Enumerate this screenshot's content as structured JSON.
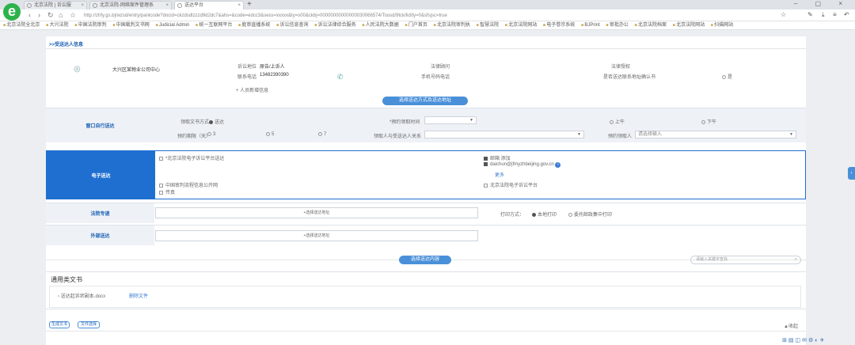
{
  "browser": {
    "tabs": [
      {
        "label": "北京法院 | 诉讼服"
      },
      {
        "label": "北京法院-网络案件管理系"
      },
      {
        "label": "送达平台"
      }
    ],
    "url": "http://zhfy.gs.bj/wzsd/entry/panlcode?docid=ckzdsdlzzzd9d2dc7&ahs=&code=edcc3&sess=xxxxx&ty=s00&ckbj=00000000000000030066574/Toosd/9tck/lid/ty=0&sfsjsc=true",
    "bookmarks": [
      "北京法院全北京",
      "大兴法院",
      "中国法院审判",
      "中国裁判文书网",
      "Judicial Admin",
      "统一互联网平台",
      "庭审直播系统",
      "诉讼信息查询",
      "诉讼法律综合服务",
      "人民法院大数据",
      "门户首页",
      "北京法院审判执",
      "智慧法院",
      "北京法院网站",
      "电子卷宗系统",
      "BJPrint",
      "审批办公",
      "北京法院档案",
      "北京法院网站",
      "扫描网站"
    ]
  },
  "page": {
    "section_title": ">>受送达人信息",
    "party": {
      "name": "大兴区某物业公司中心",
      "type_label": "诉讼地位",
      "type_value": "原告/上诉人",
      "phone_label": "联系电话",
      "phone_value": "13482390390",
      "court_label": "法律顾问",
      "mobile_label": "手机号码电话",
      "auth_label": "法律授权",
      "verify_label": "是否送达联系地址确认书",
      "verify_value": "是"
    },
    "add_party_label": "人员新增信息",
    "select_method_button": "选择送达方式及送达地址",
    "window_block": {
      "label": "窗口自行送达",
      "mode_label": "领取文书方式",
      "mode_option": "送达",
      "date_label": "*预约领取时间",
      "am_option": "上午",
      "pm_option": "下午",
      "period_label": "预约期限（天）",
      "opt_1": "3",
      "opt_2": "5",
      "opt_3": "7",
      "relation_label": "领取人与受送达人关系",
      "recipient_label": "预约领取人",
      "recipient_placeholder": "请选择输入"
    },
    "electronic_block": {
      "label": "电子送达",
      "check_sms": "*北京法院电子诉讼平台送达",
      "check_email": "邮箱 添加",
      "email_value": "daichun@jfmyzhbeijing.gov.cn",
      "more_label": "更多",
      "check_wechat": "中国审判流程信息公开网",
      "check_other": "传真",
      "check_app": "北京法院电子诉讼平台"
    },
    "post_block": {
      "label": "法院专递",
      "address_placeholder": "+选择送达地址",
      "print_label": "打印方式：",
      "print_opt1": "本地打印",
      "print_opt2": "委托邮政集中打印"
    },
    "outside_block": {
      "label": "外部送达",
      "address_placeholder": "+选择送达地址"
    },
    "select_content_button": "选择送达内容",
    "search_placeholder": "请输入关键字查找",
    "docs_panel": {
      "title": "通用类文书",
      "file_name": "送达起诉状副本.docx",
      "file_action": "删除文件"
    },
    "footer": {
      "btn_generate": "生成文书",
      "btn_select": "文件选择",
      "collapse_label": "▲收起"
    }
  }
}
